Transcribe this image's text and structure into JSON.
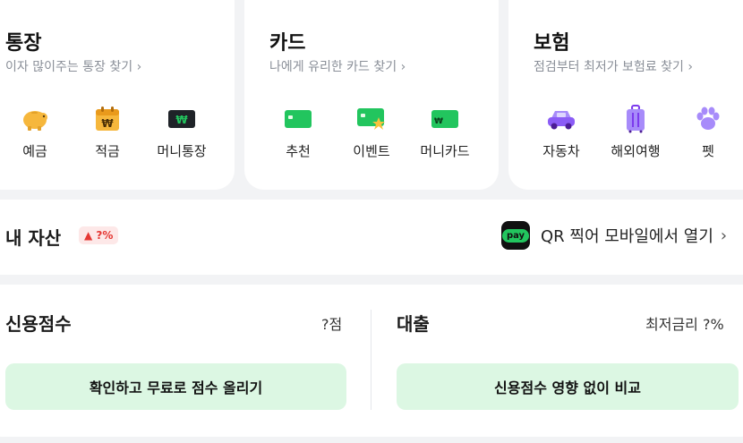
{
  "categories": {
    "bankbook": {
      "title": "통장",
      "subtitle": "이자 많이주는 통장 찾기 ›",
      "items": [
        {
          "label": "예금",
          "icon": "piggy-bank-icon"
        },
        {
          "label": "적금",
          "icon": "calendar-won-icon"
        },
        {
          "label": "머니통장",
          "icon": "money-card-icon"
        }
      ]
    },
    "card": {
      "title": "카드",
      "subtitle": "나에게 유리한 카드 찾기 ›",
      "items": [
        {
          "label": "추천",
          "icon": "card-icon"
        },
        {
          "label": "이벤트",
          "icon": "card-star-icon"
        },
        {
          "label": "머니카드",
          "icon": "money-card-green-icon"
        }
      ]
    },
    "insurance": {
      "title": "보험",
      "subtitle": "점검부터 최저가 보험료 찾기 ›",
      "items": [
        {
          "label": "자동차",
          "icon": "car-icon"
        },
        {
          "label": "해외여행",
          "icon": "suitcase-icon"
        },
        {
          "label": "펫",
          "icon": "paw-icon"
        }
      ]
    }
  },
  "assets": {
    "title": "내 자산",
    "badge": "▲ ?%",
    "pay_label": "pay",
    "qr_text": "QR 찍어 모바일에서 열기",
    "qr_chevron": "›"
  },
  "credit": {
    "title": "신용점수",
    "score": "?점",
    "button": "확인하고 무료로 점수 올리기"
  },
  "loan": {
    "title": "대출",
    "rate": "최저금리 ?%",
    "button": "신용점수 영향 없이 비교"
  },
  "colors": {
    "green": "#22c55e",
    "button_bg": "#dcf7e3",
    "badge_red": "#e53935",
    "purple": "#8b5cf6"
  }
}
